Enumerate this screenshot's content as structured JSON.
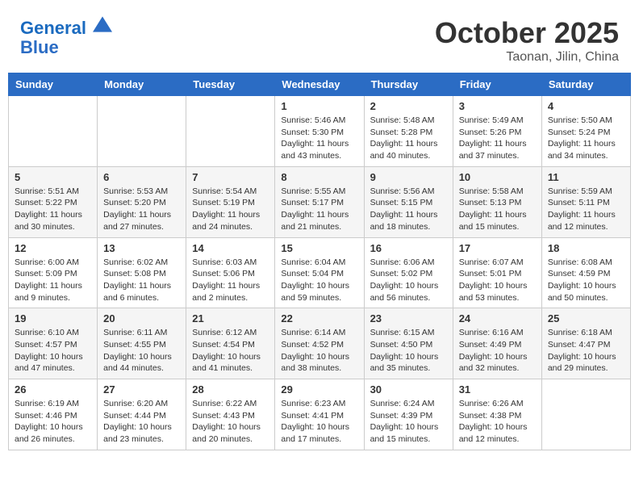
{
  "header": {
    "logo_line1": "General",
    "logo_line2": "Blue",
    "month": "October 2025",
    "location": "Taonan, Jilin, China"
  },
  "weekdays": [
    "Sunday",
    "Monday",
    "Tuesday",
    "Wednesday",
    "Thursday",
    "Friday",
    "Saturday"
  ],
  "weeks": [
    {
      "days": [
        {
          "number": "",
          "info": ""
        },
        {
          "number": "",
          "info": ""
        },
        {
          "number": "",
          "info": ""
        },
        {
          "number": "1",
          "info": "Sunrise: 5:46 AM\nSunset: 5:30 PM\nDaylight: 11 hours\nand 43 minutes."
        },
        {
          "number": "2",
          "info": "Sunrise: 5:48 AM\nSunset: 5:28 PM\nDaylight: 11 hours\nand 40 minutes."
        },
        {
          "number": "3",
          "info": "Sunrise: 5:49 AM\nSunset: 5:26 PM\nDaylight: 11 hours\nand 37 minutes."
        },
        {
          "number": "4",
          "info": "Sunrise: 5:50 AM\nSunset: 5:24 PM\nDaylight: 11 hours\nand 34 minutes."
        }
      ]
    },
    {
      "days": [
        {
          "number": "5",
          "info": "Sunrise: 5:51 AM\nSunset: 5:22 PM\nDaylight: 11 hours\nand 30 minutes."
        },
        {
          "number": "6",
          "info": "Sunrise: 5:53 AM\nSunset: 5:20 PM\nDaylight: 11 hours\nand 27 minutes."
        },
        {
          "number": "7",
          "info": "Sunrise: 5:54 AM\nSunset: 5:19 PM\nDaylight: 11 hours\nand 24 minutes."
        },
        {
          "number": "8",
          "info": "Sunrise: 5:55 AM\nSunset: 5:17 PM\nDaylight: 11 hours\nand 21 minutes."
        },
        {
          "number": "9",
          "info": "Sunrise: 5:56 AM\nSunset: 5:15 PM\nDaylight: 11 hours\nand 18 minutes."
        },
        {
          "number": "10",
          "info": "Sunrise: 5:58 AM\nSunset: 5:13 PM\nDaylight: 11 hours\nand 15 minutes."
        },
        {
          "number": "11",
          "info": "Sunrise: 5:59 AM\nSunset: 5:11 PM\nDaylight: 11 hours\nand 12 minutes."
        }
      ]
    },
    {
      "days": [
        {
          "number": "12",
          "info": "Sunrise: 6:00 AM\nSunset: 5:09 PM\nDaylight: 11 hours\nand 9 minutes."
        },
        {
          "number": "13",
          "info": "Sunrise: 6:02 AM\nSunset: 5:08 PM\nDaylight: 11 hours\nand 6 minutes."
        },
        {
          "number": "14",
          "info": "Sunrise: 6:03 AM\nSunset: 5:06 PM\nDaylight: 11 hours\nand 2 minutes."
        },
        {
          "number": "15",
          "info": "Sunrise: 6:04 AM\nSunset: 5:04 PM\nDaylight: 10 hours\nand 59 minutes."
        },
        {
          "number": "16",
          "info": "Sunrise: 6:06 AM\nSunset: 5:02 PM\nDaylight: 10 hours\nand 56 minutes."
        },
        {
          "number": "17",
          "info": "Sunrise: 6:07 AM\nSunset: 5:01 PM\nDaylight: 10 hours\nand 53 minutes."
        },
        {
          "number": "18",
          "info": "Sunrise: 6:08 AM\nSunset: 4:59 PM\nDaylight: 10 hours\nand 50 minutes."
        }
      ]
    },
    {
      "days": [
        {
          "number": "19",
          "info": "Sunrise: 6:10 AM\nSunset: 4:57 PM\nDaylight: 10 hours\nand 47 minutes."
        },
        {
          "number": "20",
          "info": "Sunrise: 6:11 AM\nSunset: 4:55 PM\nDaylight: 10 hours\nand 44 minutes."
        },
        {
          "number": "21",
          "info": "Sunrise: 6:12 AM\nSunset: 4:54 PM\nDaylight: 10 hours\nand 41 minutes."
        },
        {
          "number": "22",
          "info": "Sunrise: 6:14 AM\nSunset: 4:52 PM\nDaylight: 10 hours\nand 38 minutes."
        },
        {
          "number": "23",
          "info": "Sunrise: 6:15 AM\nSunset: 4:50 PM\nDaylight: 10 hours\nand 35 minutes."
        },
        {
          "number": "24",
          "info": "Sunrise: 6:16 AM\nSunset: 4:49 PM\nDaylight: 10 hours\nand 32 minutes."
        },
        {
          "number": "25",
          "info": "Sunrise: 6:18 AM\nSunset: 4:47 PM\nDaylight: 10 hours\nand 29 minutes."
        }
      ]
    },
    {
      "days": [
        {
          "number": "26",
          "info": "Sunrise: 6:19 AM\nSunset: 4:46 PM\nDaylight: 10 hours\nand 26 minutes."
        },
        {
          "number": "27",
          "info": "Sunrise: 6:20 AM\nSunset: 4:44 PM\nDaylight: 10 hours\nand 23 minutes."
        },
        {
          "number": "28",
          "info": "Sunrise: 6:22 AM\nSunset: 4:43 PM\nDaylight: 10 hours\nand 20 minutes."
        },
        {
          "number": "29",
          "info": "Sunrise: 6:23 AM\nSunset: 4:41 PM\nDaylight: 10 hours\nand 17 minutes."
        },
        {
          "number": "30",
          "info": "Sunrise: 6:24 AM\nSunset: 4:39 PM\nDaylight: 10 hours\nand 15 minutes."
        },
        {
          "number": "31",
          "info": "Sunrise: 6:26 AM\nSunset: 4:38 PM\nDaylight: 10 hours\nand 12 minutes."
        },
        {
          "number": "",
          "info": ""
        }
      ]
    }
  ]
}
